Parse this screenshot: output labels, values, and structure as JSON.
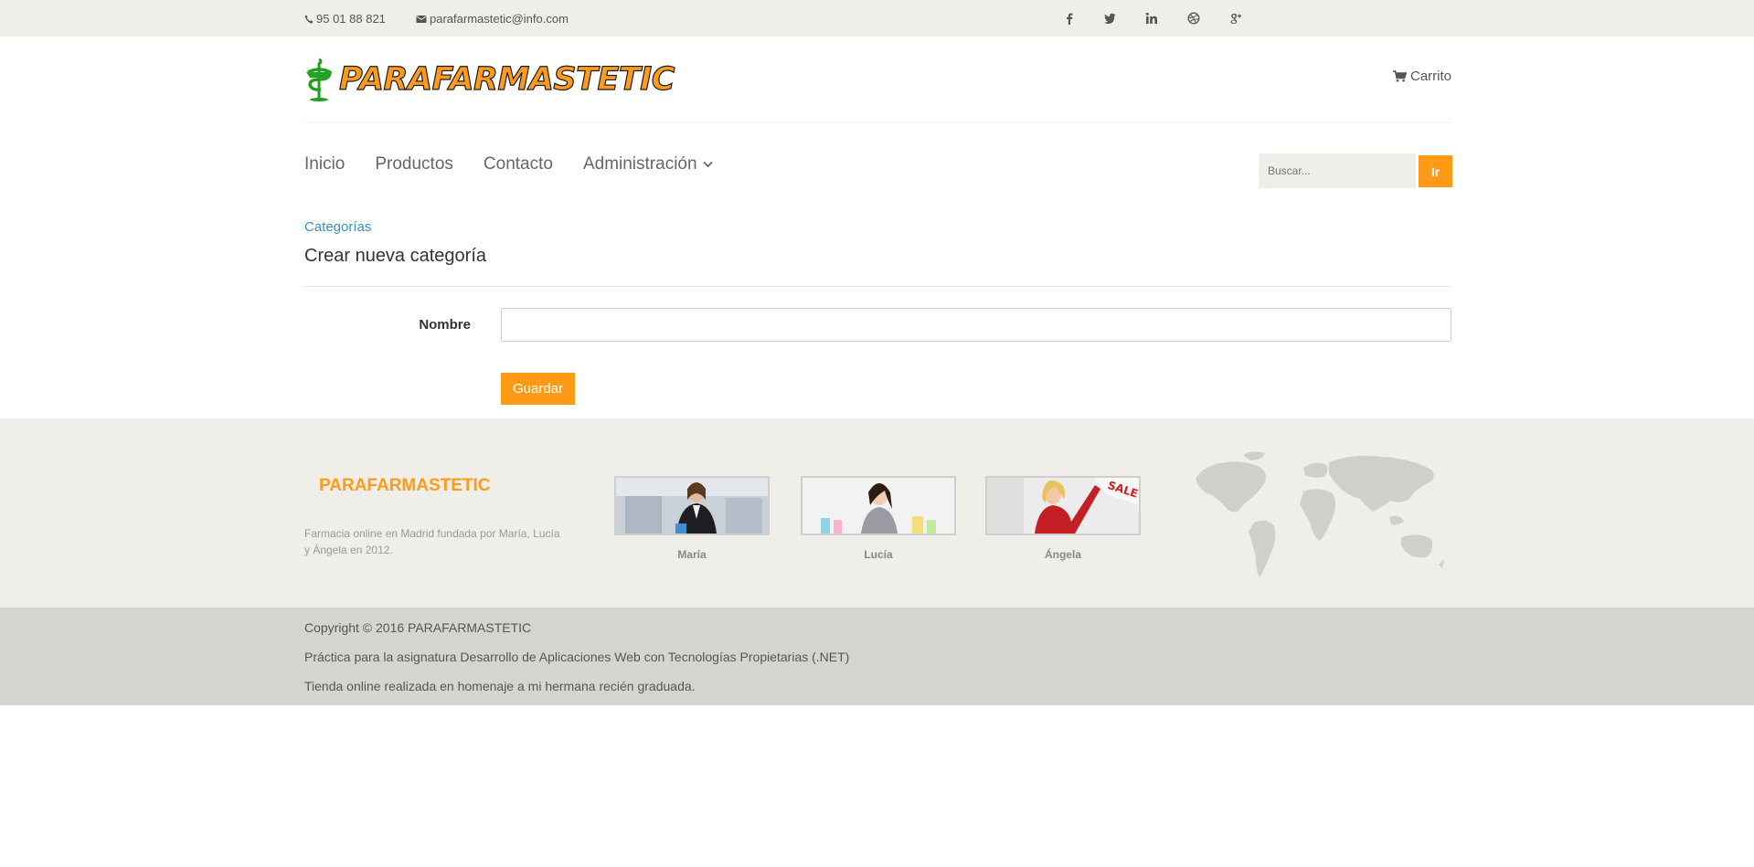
{
  "topbar": {
    "phone": "95 01 88 821",
    "email": "parafarmastetic@info.com",
    "social_icons": [
      "facebook-icon",
      "twitter-icon",
      "linkedin-icon",
      "dribbble-icon",
      "google-plus-icon"
    ]
  },
  "header": {
    "logo_text": "PARAFARMASTETIC",
    "cart_label": "Carrito"
  },
  "nav": {
    "items": [
      {
        "label": "Inicio"
      },
      {
        "label": "Productos"
      },
      {
        "label": "Contacto"
      },
      {
        "label": "Administración",
        "has_dropdown": true
      }
    ]
  },
  "search": {
    "placeholder": "Buscar...",
    "button_label": "Ir"
  },
  "breadcrumb": "Categorías",
  "page_title": "Crear nueva categoría",
  "form": {
    "name_label": "Nombre",
    "name_value": "",
    "save_label": "Guardar"
  },
  "footer": {
    "brand": "PARAFARMASTETIC",
    "description": "Farmacia online en Madrid fundada por María, Lucía y Ángela en 2012.",
    "members": [
      {
        "name": "María"
      },
      {
        "name": "Lucía"
      },
      {
        "name": "Ángela"
      }
    ]
  },
  "copyright": {
    "line1": "Copyright © 2016 PARAFARMASTETIC",
    "line2": "Práctica para la asignatura Desarrollo de Aplicaciones Web con Tecnologías Propietarias (.NET)",
    "line3": "Tienda online realizada en homenaje a mi hermana recién graduada."
  },
  "colors": {
    "accent": "#ff9a16",
    "topbar_bg": "#efeee8",
    "link": "#3a8fc9",
    "copyright_bg": "#d5d5cf"
  }
}
